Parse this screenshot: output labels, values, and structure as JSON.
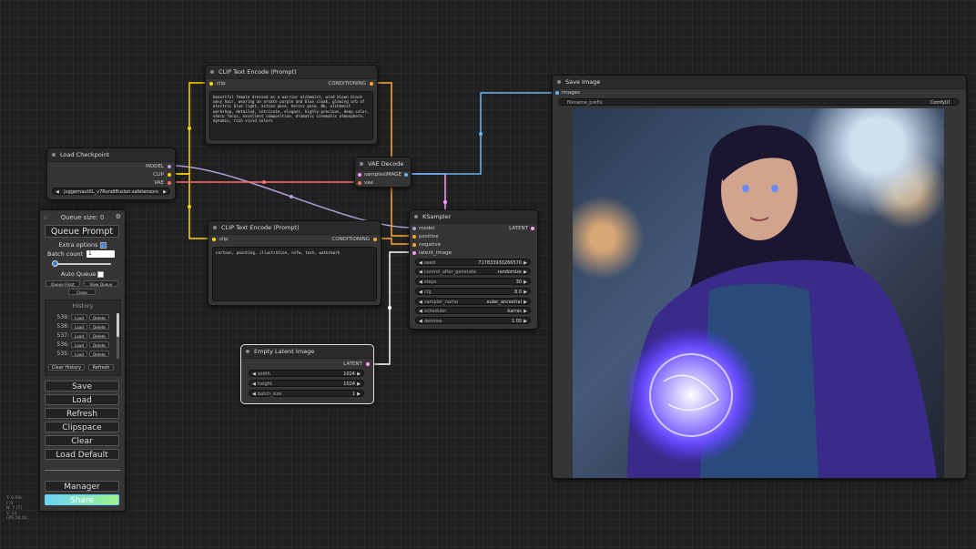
{
  "nodes": {
    "clip_top": {
      "title": "CLIP Text Encode (Prompt)",
      "input_clip": "clip",
      "output": "CONDITIONING",
      "text": "beautiful female dressed as a warrior alchemist, wind blown black wavy hair, wearing an ornate purple and blue cloak, glowing orb of electric blue light, action pose, heroic pose, 8k, alchemist workshop, detailed, intricate, elegant, highly precious, deep color, sharp focus, excellent composition, dramatic cinematic atmosphere, dynamic, rich vivid colors"
    },
    "clip_bottom": {
      "title": "CLIP Text Encode (Prompt)",
      "input_clip": "clip",
      "output": "CONDITIONING",
      "text": "cartoon, painting, illustration, nsfw, text, watermark"
    },
    "checkpoint": {
      "title": "Load Checkpoint",
      "outputs": [
        "MODEL",
        "CLIP",
        "VAE"
      ],
      "ckpt_name": "juggernautXL_v7Rundiffusion.safetensors"
    },
    "vae_decode": {
      "title": "VAE Decode",
      "inputs": [
        "samples",
        "vae"
      ],
      "output": "IMAGE"
    },
    "ksampler": {
      "title": "KSampler",
      "inputs": [
        "model",
        "positive",
        "negative",
        "latent_image"
      ],
      "output": "LATENT",
      "widgets": [
        {
          "name": "seed",
          "value": "717833930266570"
        },
        {
          "name": "control_after_generate",
          "value": "randomize"
        },
        {
          "name": "steps",
          "value": "30"
        },
        {
          "name": "cfg",
          "value": "8.0"
        },
        {
          "name": "sampler_name",
          "value": "euler_ancestral"
        },
        {
          "name": "scheduler",
          "value": "karras"
        },
        {
          "name": "denoise",
          "value": "1.00"
        }
      ]
    },
    "empty_latent": {
      "title": "Empty Latent Image",
      "output": "LATENT",
      "widgets": [
        {
          "name": "width",
          "value": "1024"
        },
        {
          "name": "height",
          "value": "1024"
        },
        {
          "name": "batch_size",
          "value": "1"
        }
      ]
    },
    "save_image": {
      "title": "Save Image",
      "input": "images",
      "prefix_label": "filename_prefix",
      "prefix_value": "ComfyUI"
    }
  },
  "menu": {
    "queue_size": "Queue size: 0",
    "queue_prompt": "Queue Prompt",
    "extra_options": "Extra options",
    "extra_options_checked": true,
    "batch_count_label": "Batch count",
    "batch_count_value": "1",
    "auto_queue": "Auto Queue",
    "queue_front": "Queue Front",
    "view_queue": "View Queue",
    "close": "Close",
    "history_label": "History",
    "history": [
      {
        "num": "539:",
        "load": "Load",
        "delete": "Delete"
      },
      {
        "num": "538:",
        "load": "Load",
        "delete": "Delete"
      },
      {
        "num": "537:",
        "load": "Load",
        "delete": "Delete"
      },
      {
        "num": "536:",
        "load": "Load",
        "delete": "Delete"
      },
      {
        "num": "535:",
        "load": "Load",
        "delete": "Delete"
      }
    ],
    "clear_history": "Clear History",
    "refresh_small": "Refresh",
    "save": "Save",
    "load": "Load",
    "refresh": "Refresh",
    "clipspace": "Clipspace",
    "clear": "Clear",
    "load_default": "Load Default",
    "manager": "Manager",
    "share": "Share"
  },
  "stats": [
    "T: 0.00s",
    "I: 0",
    "N: 7 [7]",
    "V: 14",
    "FPS:59.02"
  ],
  "colors": {
    "model": "#b39ddb",
    "clip": "#ffd500",
    "vae": "#ff6e6e",
    "conditioning": "#ffa931",
    "latent": "#ff9cf9",
    "image": "#64b5f6",
    "share_start": "#6ad5f7",
    "share_end": "#9ef28a"
  }
}
